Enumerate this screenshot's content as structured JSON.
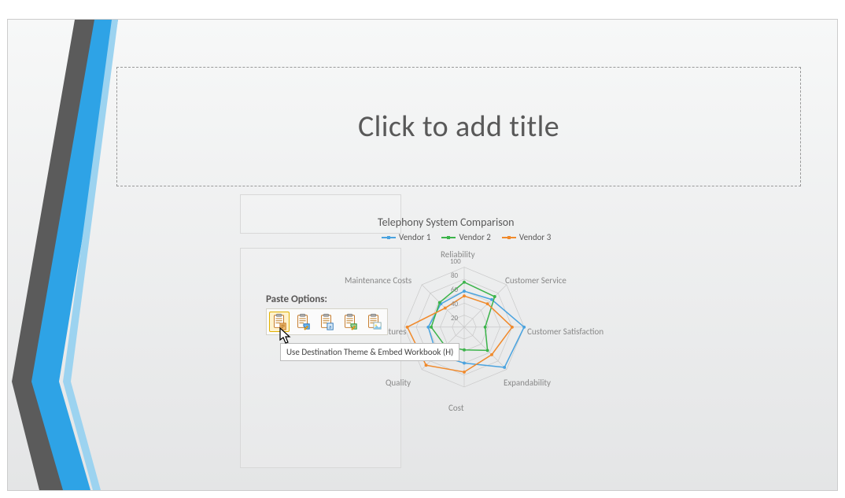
{
  "title_placeholder": "Click to add title",
  "paste": {
    "label": "Paste Options:",
    "tooltip": "Use Destination Theme & Embed Workbook (H)",
    "options": [
      {
        "name": "use-destination-theme-embed",
        "hover": true
      },
      {
        "name": "keep-source-formatting-embed",
        "hover": false
      },
      {
        "name": "use-destination-theme-link",
        "hover": false
      },
      {
        "name": "keep-source-formatting-link",
        "hover": false
      },
      {
        "name": "paste-as-picture",
        "hover": false
      }
    ]
  },
  "chart_data": {
    "type": "radar",
    "title": "Telephony System Comparison",
    "categories": [
      "Reliability",
      "Customer Service",
      "Customer Satisfaction",
      "Expandability",
      "Cost",
      "Quality",
      "Features",
      "Maintenance Costs"
    ],
    "axis_ticks": [
      20,
      40,
      60,
      80,
      100
    ],
    "max": 100,
    "series": [
      {
        "name": "Vendor 1",
        "color": "#4aa3df",
        "values": [
          60,
          65,
          100,
          95,
          60,
          65,
          60,
          55
        ]
      },
      {
        "name": "Vendor 2",
        "color": "#3cb44b",
        "values": [
          75,
          72,
          35,
          55,
          38,
          45,
          55,
          58
        ]
      },
      {
        "name": "Vendor 3",
        "color": "#f08a2c",
        "values": [
          52,
          55,
          80,
          65,
          75,
          90,
          95,
          45
        ]
      }
    ]
  },
  "colors": {
    "stripe_blue": "#1e90e6",
    "stripe_gray": "#5b5b5b"
  }
}
